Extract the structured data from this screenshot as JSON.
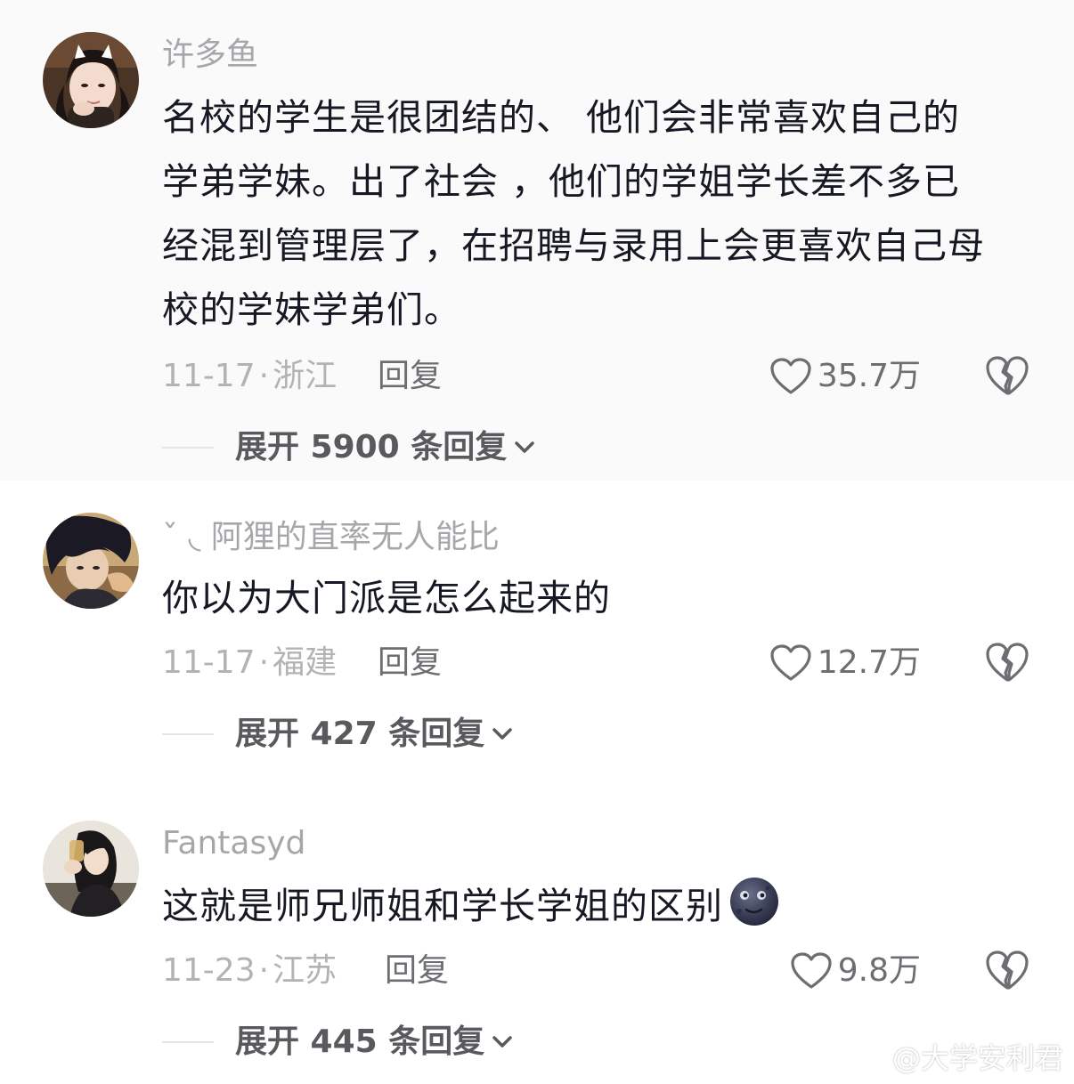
{
  "comments": [
    {
      "username": "许多鱼",
      "text_lines": [
        "名校的学生是很团结的、 他们会非常喜欢自己的",
        "学弟学妹。出了社会 ，他们的学姐学长差不多已",
        "经混到管理层了，在招聘与录用上会更喜欢自己母",
        "校的学妹学弟们。"
      ],
      "date": "11-17",
      "separator": "·",
      "location": "浙江",
      "reply_label": "回复",
      "likes": "35.7万",
      "expand_label": "展开 5900 条回复",
      "avatar_icon": "avatar-girl-cat-ears"
    },
    {
      "username": "ˇ ◟ 阿狸的直率无人能比",
      "text": "你以为大门派是怎么起来的",
      "date": "11-17",
      "separator": "·",
      "location": "福建",
      "reply_label": "回复",
      "likes": "12.7万",
      "expand_label": "展开 427 条回复",
      "avatar_icon": "avatar-anime-boy"
    },
    {
      "username": "Fantasyd",
      "text": "这就是师兄师姐和学长学姐的区别",
      "emoji": "new-moon-face-emoji",
      "date": "11-23",
      "separator": "·",
      "location": "江苏",
      "reply_label": "回复",
      "likes": "9.8万",
      "expand_label": "展开 445 条回复",
      "avatar_icon": "avatar-girl-drink"
    }
  ],
  "watermark": {
    "icon": "weibo-icon",
    "text": "@大学安利君"
  },
  "icons": {
    "like": "heart-outline-icon",
    "dislike": "broken-heart-icon",
    "expand": "chevron-down-icon"
  },
  "colors": {
    "text_primary": "#161823",
    "text_secondary": "#a7a7ab",
    "reply": "#6e6e72",
    "highlight_bg": "#fafafa"
  }
}
